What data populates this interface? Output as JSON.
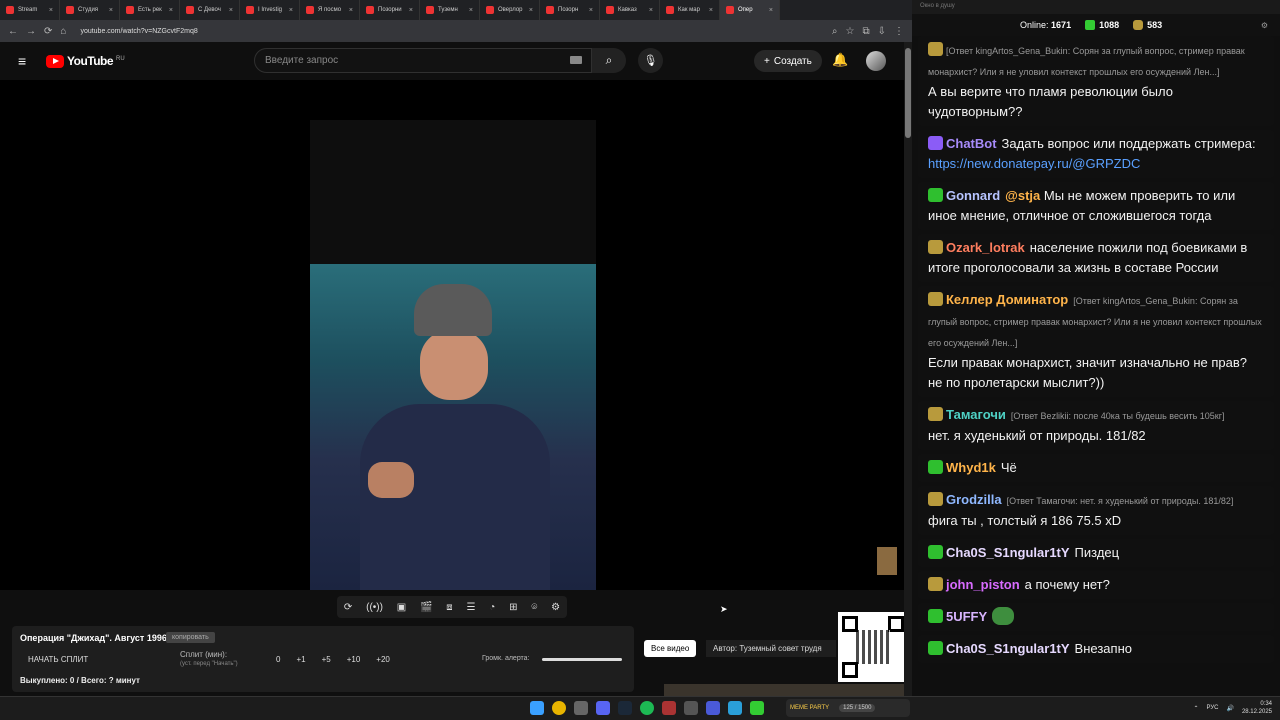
{
  "browser": {
    "tabs": [
      {
        "label": "Stream",
        "active": false
      },
      {
        "label": "Студия",
        "active": false
      },
      {
        "label": "Есть рек",
        "active": false
      },
      {
        "label": "С Девоч",
        "active": false
      },
      {
        "label": "I Investig",
        "active": false
      },
      {
        "label": "Я посмо",
        "active": false
      },
      {
        "label": "Позорни",
        "active": false
      },
      {
        "label": "Туземн",
        "active": false
      },
      {
        "label": "Оверлор",
        "active": false
      },
      {
        "label": "Позорн",
        "active": false
      },
      {
        "label": "Кавказ",
        "active": false
      },
      {
        "label": "Как мар",
        "active": false
      },
      {
        "label": "Опер",
        "active": true
      }
    ],
    "url": "youtube.com/watch?v=NZGcvtF2mq8"
  },
  "youtube": {
    "logo_text": "YouTube",
    "logo_region": "RU",
    "search_placeholder": "Введите запрос",
    "create_label": "Создать"
  },
  "donation_panel": {
    "video_title": "Операция \"Джихад\". Август 1996.",
    "copy_label": "копировать",
    "split_start": "НАЧАТЬ СПЛИТ",
    "split_label": "Сплит (мин):",
    "split_hint": "(уст. перед \"Начать\")",
    "split_value": "0",
    "increments": [
      "+1",
      "+5",
      "+10",
      "+20"
    ],
    "volume_label": "Громк. алерта:",
    "volume_level": 1.0,
    "bought": "Выкуплено: 0 / Всего: ? минут",
    "all_videos": "Все видео",
    "author": "Автор: Туземный совет трудя"
  },
  "chat_window": {
    "title": "Окно в душу",
    "online_label": "Online:",
    "online_count": "1671",
    "kick_count": "1088",
    "cup_count": "583"
  },
  "chat": [
    {
      "nick": "",
      "color": "#a78bfa",
      "badge": "#b89a3c",
      "reply": "[Ответ kingArtos_Gena_Bukin: Сорян за глупый вопрос, стример правак монархист? Или я не уловил контекст прошлых его осуждений Лен...]",
      "text": "А вы верите что пламя революции было чудотворным??"
    },
    {
      "nick": "ChatBot",
      "color": "#a78bfa",
      "badge": "#8b5cf6",
      "reply": "",
      "text": "Задать вопрос или поддержать стримера:",
      "link": "https://new.donatepay.ru/@GRPZDC"
    },
    {
      "nick": "Gonnard",
      "color": "#b7c4ff",
      "badge": "#2fbf2f",
      "mention": "@stja",
      "reply": "",
      "text": "Мы не можем проверить то или иное мнение, отличное от сложившегося тогда"
    },
    {
      "nick": "Ozark_lotrak",
      "color": "#ff7e5f",
      "badge": "#b89a3c",
      "reply": "",
      "text": "население пожили под боевиками в итоге проголосовали за жизнь в составе России"
    },
    {
      "nick": "Келлер Доминатор",
      "color": "#ffb44a",
      "badge": "#b89a3c",
      "reply": "[Ответ kingArtos_Gena_Bukin: Сорян за глупый вопрос, стример правак монархист? Или я не уловил контекст прошлых его осуждений Лен...]",
      "text": "Если правак монархист, значит изначально не прав? не по пролетарски мыслит?))"
    },
    {
      "nick": "Тамагочи",
      "color": "#4fd1c5",
      "badge": "#b89a3c",
      "reply": "[Ответ Bezlikii: после 40ка ты будешь весить 105кг]",
      "text": "нет. я худенький от природы. 181/82"
    },
    {
      "nick": "Whyd1k",
      "color": "#ffb44a",
      "badge": "#2fbf2f",
      "reply": "",
      "text": "Чё"
    },
    {
      "nick": "Grodzilla",
      "color": "#8fb8ff",
      "badge": "#b89a3c",
      "reply": "[Ответ Тамагочи: нет. я худенький от природы. 181/82]",
      "text": "фига ты , толстый я 186 75.5 xD"
    },
    {
      "nick": "Cha0S_S1ngular1tY",
      "color": "#e6d9ff",
      "badge": "#2fbf2f",
      "reply": "",
      "text": "Пиздец"
    },
    {
      "nick": "john_piston",
      "color": "#d86bff",
      "badge": "#b89a3c",
      "reply": "",
      "text": "а почему нет?"
    },
    {
      "nick": "5UFFY",
      "color": "#d8b4fe",
      "badge": "#2fbf2f",
      "reply": "",
      "text": "",
      "emote": "pepe-emote"
    },
    {
      "nick": "Cha0S_S1ngular1tY",
      "color": "#e6d9ff",
      "badge": "#2fbf2f",
      "reply": "",
      "text": "Внезапно"
    }
  ],
  "taskbar": {
    "meme_party": "MEME PARTY",
    "meme_progress": "125 / 1500",
    "lang": "РУС",
    "time": "0:34",
    "date": "28.12.2025"
  }
}
